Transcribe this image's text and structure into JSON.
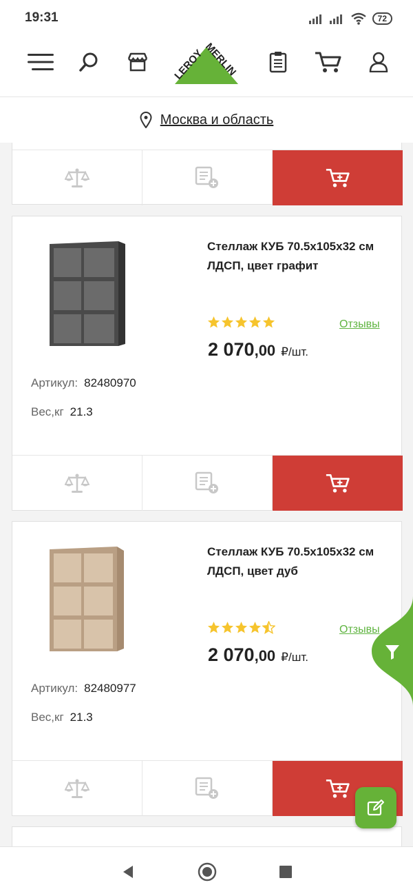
{
  "status": {
    "time": "19:31",
    "battery": "72"
  },
  "header": {
    "logo_text": "LEROY MERLIN",
    "icons": [
      "menu-icon",
      "search-icon",
      "store-icon",
      "shopping-list-icon",
      "cart-icon",
      "profile-icon"
    ]
  },
  "location": {
    "label": "Москва и область"
  },
  "colors": {
    "brand_green": "#66b238",
    "cart_red": "#cf3d36",
    "star_yellow": "#f6c42d",
    "review_green": "#5fb440"
  },
  "products": [
    {
      "title": "Стеллаж КУБ 70.5x105x32 см ЛДСП, цвет графит",
      "rating": 5,
      "reviews_label": "Отзывы",
      "price_int": "2 070",
      "price_frac": ",00",
      "price_unit": "₽/шт.",
      "article_label": "Артикул:",
      "article": "82480970",
      "weight_label": "Вес,кг",
      "weight": "21.3",
      "color": "graphite"
    },
    {
      "title": "Стеллаж КУБ 70.5x105x32 см ЛДСП, цвет дуб",
      "rating": 4.5,
      "reviews_label": "Отзывы",
      "price_int": "2 070",
      "price_frac": ",00",
      "price_unit": "₽/шт.",
      "article_label": "Артикул:",
      "article": "82480977",
      "weight_label": "Вес,кг",
      "weight": "21.3",
      "color": "oak"
    }
  ]
}
